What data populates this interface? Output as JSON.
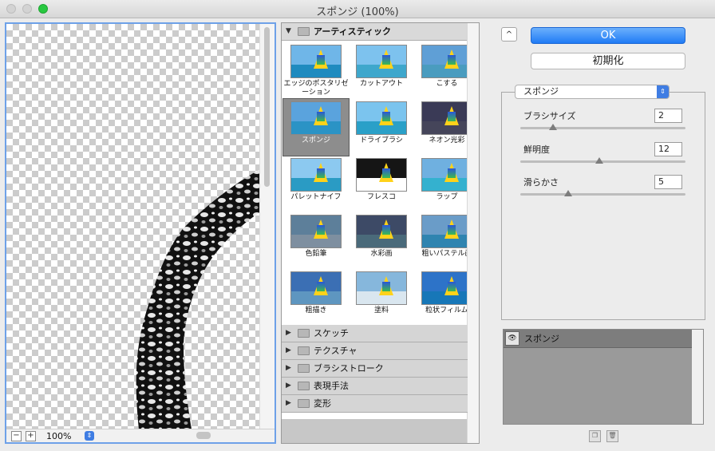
{
  "window": {
    "title": "スポンジ (100%)"
  },
  "preview": {
    "zoom": "100%",
    "zoom_out": "−",
    "zoom_in": "+"
  },
  "gallery": {
    "open_category": "アーティスティック",
    "filters": [
      {
        "label": "エッジのポスタリゼーション",
        "selected": false
      },
      {
        "label": "カットアウト",
        "selected": false
      },
      {
        "label": "こする",
        "selected": false
      },
      {
        "label": "スポンジ",
        "selected": true
      },
      {
        "label": "ドライブラシ",
        "selected": false
      },
      {
        "label": "ネオン光彩",
        "selected": false
      },
      {
        "label": "パレットナイフ",
        "selected": false
      },
      {
        "label": "フレスコ",
        "selected": false
      },
      {
        "label": "ラップ",
        "selected": false
      },
      {
        "label": "色鉛筆",
        "selected": false
      },
      {
        "label": "水彩画",
        "selected": false
      },
      {
        "label": "粗いパステル画",
        "selected": false
      },
      {
        "label": "粗描き",
        "selected": false
      },
      {
        "label": "塗料",
        "selected": false
      },
      {
        "label": "粒状フィルム",
        "selected": false
      }
    ],
    "categories": [
      "スケッチ",
      "テクスチャ",
      "ブラシストローク",
      "表現手法",
      "変形"
    ]
  },
  "buttons": {
    "ok": "OK",
    "reset": "初期化",
    "collapse": "^"
  },
  "settings": {
    "filter_name": "スポンジ",
    "params": [
      {
        "label": "ブラシサイズ",
        "value": "2",
        "fraction": 0.2
      },
      {
        "label": "鮮明度",
        "value": "12",
        "fraction": 0.48
      },
      {
        "label": "滑らかさ",
        "value": "5",
        "fraction": 0.29
      }
    ]
  },
  "layers": {
    "items": [
      {
        "name": "スポンジ",
        "visible": true
      }
    ]
  }
}
